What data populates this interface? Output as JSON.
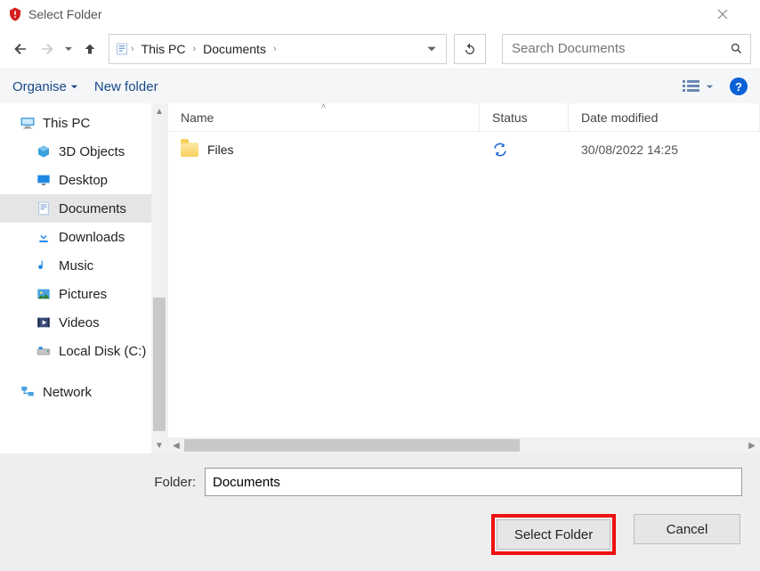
{
  "window": {
    "title": "Select Folder"
  },
  "nav": {
    "breadcrumbs": [
      "This PC",
      "Documents"
    ]
  },
  "search": {
    "placeholder": "Search Documents"
  },
  "toolbar": {
    "organise": "Organise",
    "newfolder": "New folder"
  },
  "tree": {
    "root": "This PC",
    "items": [
      {
        "label": "3D Objects"
      },
      {
        "label": "Desktop"
      },
      {
        "label": "Documents",
        "selected": true
      },
      {
        "label": "Downloads"
      },
      {
        "label": "Music"
      },
      {
        "label": "Pictures"
      },
      {
        "label": "Videos"
      },
      {
        "label": "Local Disk (C:)"
      }
    ],
    "network": "Network"
  },
  "columns": {
    "name": "Name",
    "status": "Status",
    "date": "Date modified"
  },
  "rows": [
    {
      "name": "Files",
      "date": "30/08/2022 14:25"
    }
  ],
  "footer": {
    "folder_label": "Folder:",
    "folder_value": "Documents",
    "select": "Select Folder",
    "cancel": "Cancel"
  }
}
